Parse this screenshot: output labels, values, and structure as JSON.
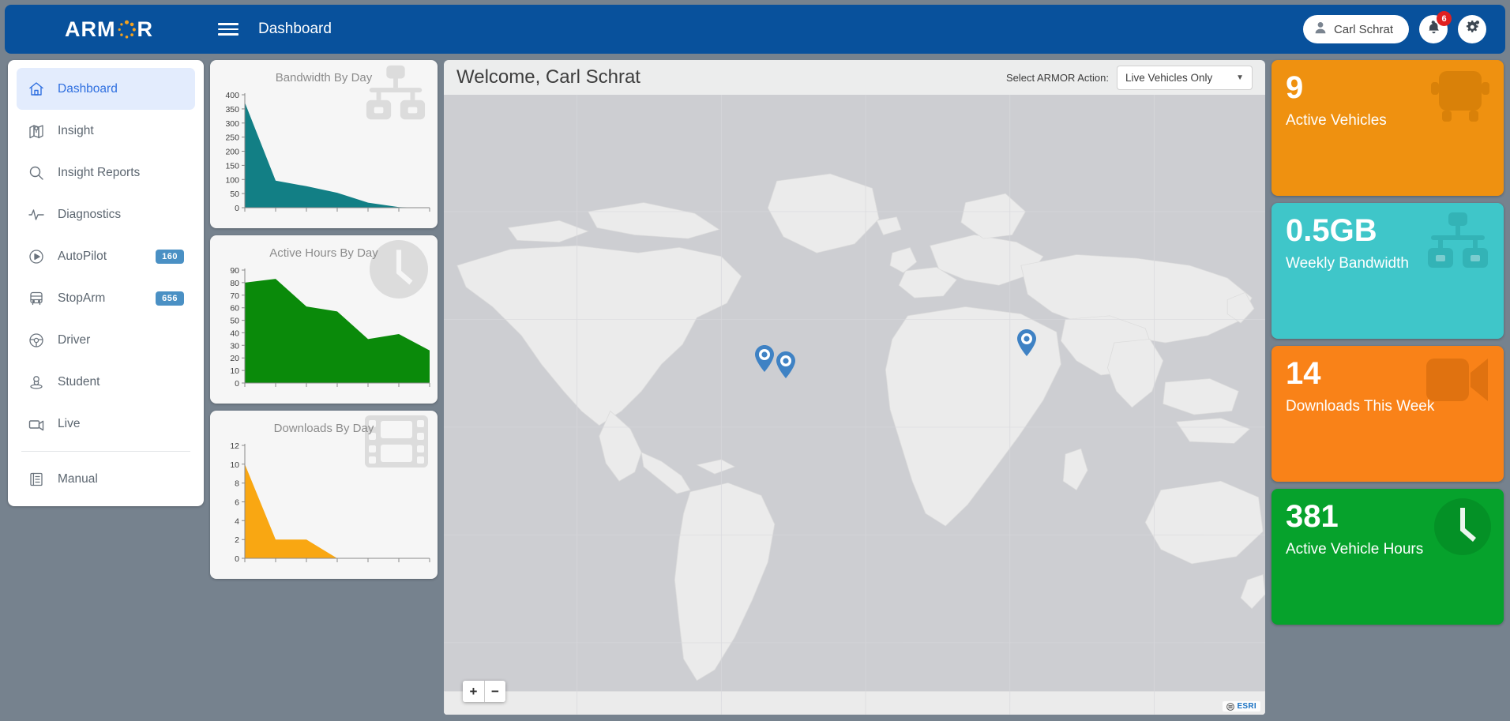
{
  "header": {
    "logo_text_left": "ARM",
    "logo_text_right": "R",
    "menu_icon": "hamburger-icon",
    "page_title": "Dashboard",
    "user_name": "Carl Schrat",
    "user_icon": "user-icon",
    "bell_icon": "bell-icon",
    "notification_count": "6",
    "settings_icon": "gear-icon",
    "bg_color": "#08519c",
    "badge_color": "#e02020"
  },
  "sidebar": {
    "items": [
      {
        "label": "Dashboard",
        "icon": "home-icon",
        "active": true,
        "badge": ""
      },
      {
        "label": "Insight",
        "icon": "map-pin-icon",
        "active": false,
        "badge": ""
      },
      {
        "label": "Insight Reports",
        "icon": "search-icon",
        "active": false,
        "badge": ""
      },
      {
        "label": "Diagnostics",
        "icon": "pulse-icon",
        "active": false,
        "badge": ""
      },
      {
        "label": "AutoPilot",
        "icon": "play-circle-icon",
        "active": false,
        "badge": "160"
      },
      {
        "label": "StopArm",
        "icon": "bus-icon",
        "active": false,
        "badge": "656"
      },
      {
        "label": "Driver",
        "icon": "steering-wheel-icon",
        "active": false,
        "badge": ""
      },
      {
        "label": "Student",
        "icon": "student-icon",
        "active": false,
        "badge": ""
      },
      {
        "label": "Live",
        "icon": "video-camera-icon",
        "active": false,
        "badge": ""
      },
      {
        "label": "Manual",
        "icon": "book-icon",
        "active": false,
        "badge": "",
        "after_separator": true
      }
    ],
    "active_color": "#2f6fe0",
    "active_bg": "#e3ecfd",
    "badge_color": "#4a90c4"
  },
  "main": {
    "welcome_title": "Welcome, Carl Schrat",
    "action_label": "Select ARMOR Action:",
    "action_selected": "Live Vehicles Only",
    "action_options": [
      "Live Vehicles Only"
    ],
    "caret_icon": "chevron-down-icon",
    "zoom_in": "+",
    "zoom_out": "−",
    "attribution": "ESRI",
    "map_ocean_color": "#cdced2",
    "map_land_color": "#ebebeb",
    "marker_color": "#3f82c4",
    "markers": [
      {
        "name": "vehicle-marker-1",
        "x": 913,
        "y": 430
      },
      {
        "name": "vehicle-marker-2",
        "x": 940,
        "y": 438
      },
      {
        "name": "vehicle-marker-3",
        "x": 1245,
        "y": 410
      }
    ]
  },
  "kpis": [
    {
      "value": "9",
      "label": "Active Vehicles",
      "color": "#ef9110",
      "icon_color": "#d98109",
      "icon": "bus-icon"
    },
    {
      "value": "0.5GB",
      "label": "Weekly Bandwidth",
      "color": "#3fc6c9",
      "icon_color": "#33b3b6",
      "icon": "network-icon"
    },
    {
      "value": "14",
      "label": "Downloads This Week",
      "color": "#f98218",
      "icon_color": "#e07210",
      "icon": "video-camera-icon"
    },
    {
      "value": "381",
      "label": "Active Vehicle Hours",
      "color": "#06a22c",
      "icon_color": "#049126",
      "icon": "clock-icon"
    }
  ],
  "chart_data": [
    {
      "type": "area",
      "title": "Bandwidth By Day",
      "color": "#127f85",
      "icon": "network-icon",
      "x": [
        0,
        1,
        2,
        3,
        4,
        5,
        6
      ],
      "categories": [
        "",
        "",
        "",
        "",
        "",
        "",
        ""
      ],
      "values": [
        373,
        96,
        76,
        53,
        18,
        2,
        0
      ],
      "yticks": [
        0,
        50,
        100,
        150,
        200,
        250,
        300,
        350,
        400
      ],
      "ylim": [
        0,
        400
      ],
      "xlabel": "",
      "ylabel": "",
      "grid": false,
      "legend": "none"
    },
    {
      "type": "area",
      "title": "Active Hours By Day",
      "color": "#0a8a0a",
      "icon": "clock-icon",
      "x": [
        0,
        1,
        2,
        3,
        4,
        5,
        6
      ],
      "categories": [
        "",
        "",
        "",
        "",
        "",
        "",
        ""
      ],
      "values": [
        80,
        83,
        61,
        57,
        35,
        39,
        26
      ],
      "yticks": [
        0,
        10,
        20,
        30,
        40,
        50,
        60,
        70,
        80,
        90
      ],
      "ylim": [
        0,
        90
      ],
      "xlabel": "",
      "ylabel": "",
      "grid": false,
      "legend": "none"
    },
    {
      "type": "area",
      "title": "Downloads By Day",
      "color": "#f9a712",
      "icon": "film-icon",
      "x": [
        0,
        1,
        2,
        3,
        4,
        5,
        6
      ],
      "categories": [
        "",
        "",
        "",
        "",
        "",
        "",
        ""
      ],
      "values": [
        10,
        2,
        2,
        0,
        0,
        0,
        0
      ],
      "yticks": [
        0,
        2,
        4,
        6,
        8,
        10,
        12
      ],
      "ylim": [
        0,
        12
      ],
      "xlabel": "",
      "ylabel": "",
      "grid": false,
      "legend": "none"
    }
  ]
}
